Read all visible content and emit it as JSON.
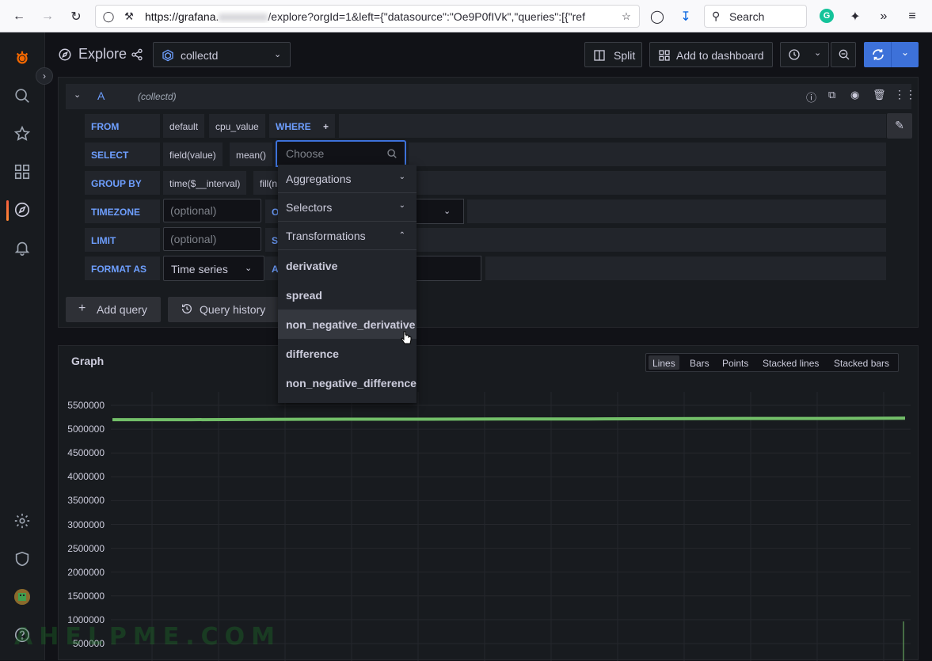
{
  "browser": {
    "url_host": "https://grafana.",
    "url_rest": "/explore?orgId=1&left={\"datasource\":\"Oe9P0fIVk\",\"queries\":[{\"ref",
    "search_placeholder": "Search"
  },
  "header": {
    "title": "Explore",
    "datasource": "collectd",
    "split_label": "Split",
    "add_to_dashboard_label": "Add to dashboard"
  },
  "query": {
    "ref_id": "A",
    "ds_name": "(collectd)",
    "rows": {
      "from": {
        "label": "FROM",
        "policy": "default",
        "measurement": "cpu_value",
        "where": "WHERE",
        "plus": "+"
      },
      "select": {
        "label": "SELECT",
        "field": "field(value)",
        "agg": "mean()",
        "choose_placeholder": "Choose"
      },
      "group_by": {
        "label": "GROUP BY",
        "time": "time($__interval)",
        "fill": "fill(n"
      },
      "timezone": {
        "label": "TIMEZONE",
        "placeholder": "(optional)",
        "next": "O"
      },
      "limit": {
        "label": "LIMIT",
        "placeholder": "(optional)",
        "next": "S"
      },
      "format_as": {
        "label": "FORMAT AS",
        "value": "Time series",
        "next": "A"
      }
    },
    "add_query_label": "Add query",
    "query_history_label": "Query history"
  },
  "dropdown": {
    "groups": [
      {
        "label": "Aggregations",
        "expanded": false
      },
      {
        "label": "Selectors",
        "expanded": false
      },
      {
        "label": "Transformations",
        "expanded": true
      }
    ],
    "items": [
      "derivative",
      "spread",
      "non_negative_derivative",
      "difference",
      "non_negative_difference"
    ],
    "highlighted_index": 2
  },
  "graph": {
    "title": "Graph",
    "modes": [
      "Lines",
      "Bars",
      "Points",
      "Stacked lines",
      "Stacked bars"
    ],
    "active_mode": "Lines",
    "line_color": "#73bf69"
  },
  "chart_data": {
    "type": "line",
    "y_ticks": [
      "5500000",
      "5000000",
      "4500000",
      "4000000",
      "3500000",
      "3000000",
      "2500000",
      "2000000",
      "1500000",
      "1000000",
      "500000"
    ],
    "ylim": [
      500000,
      5500000
    ],
    "series": [
      {
        "values": [
          5200000,
          5200000,
          5205000,
          5210000,
          5210000,
          5215000,
          5215000,
          5220000,
          5225000,
          5225000,
          5230000
        ]
      }
    ]
  },
  "watermark": "AHELPME.COM"
}
